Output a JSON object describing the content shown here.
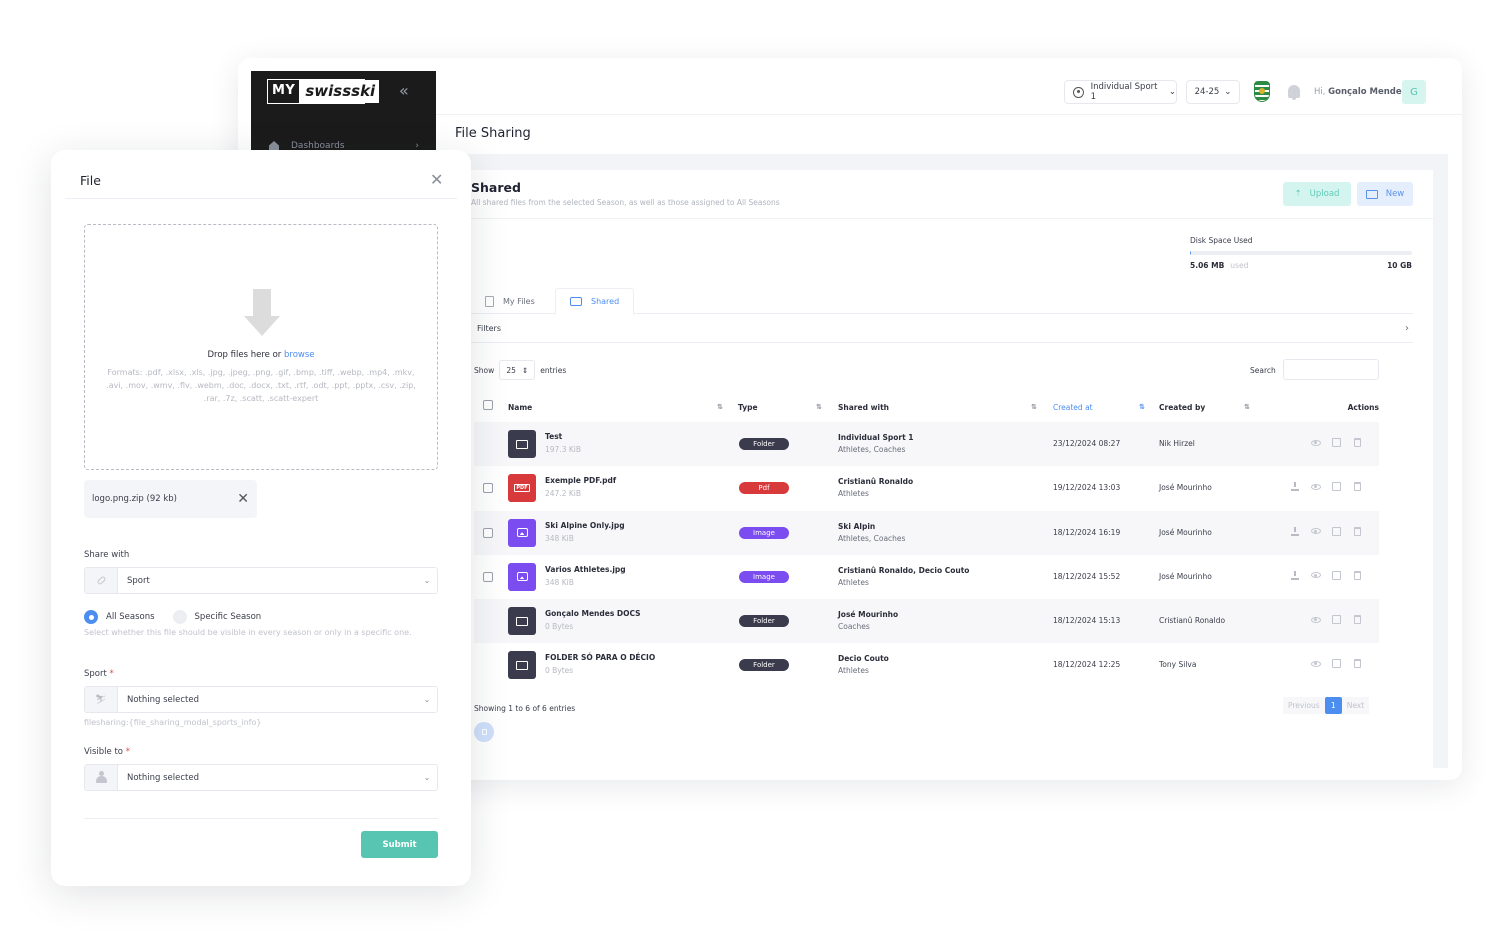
{
  "app": {
    "logo_left": "MY",
    "logo_right": "swissski",
    "sidebar_items": [
      {
        "label": "Dashboards",
        "icon": "home-icon"
      }
    ],
    "page_title": "File Sharing"
  },
  "topbar": {
    "sport_selector": "Individual Sport 1",
    "season_selector": "24-25",
    "greeting_prefix": "Hi,",
    "user_name": "Gonçalo Mendes",
    "avatar_initial": "G"
  },
  "card": {
    "title": "Shared",
    "subtitle": "All shared files from the selected Season, as well as those assigned to All Seasons",
    "upload_label": "Upload",
    "new_label": "New",
    "disk": {
      "label": "Disk Space Used",
      "used": "5.06 MB",
      "used_suffix": "used",
      "total": "10 GB",
      "fraction_used": 0.0005
    },
    "tabs": [
      {
        "label": "My Files",
        "active": false
      },
      {
        "label": "Shared",
        "active": true
      }
    ],
    "filters_label": "Filters",
    "show_label": "Show",
    "entries_value": "25",
    "entries_label": "entries",
    "search_label": "Search",
    "search_value": ""
  },
  "table": {
    "columns": [
      "Name",
      "Type",
      "Shared with",
      "Created at",
      "Created by",
      "Actions"
    ],
    "sorted_column": "Created at",
    "rows": [
      {
        "name": "Test",
        "size": "197.3 KiB",
        "kind": "folder",
        "type": "Folder",
        "shared_with": "Individual Sport 1",
        "shared_roles": "Athletes, Coaches",
        "created_at": "23/12/2024 08:27",
        "created_by": "Nik Hirzel",
        "has_checkbox": false,
        "downloadable": false
      },
      {
        "name": "Exemple PDF.pdf",
        "size": "247.2 KiB",
        "kind": "pdf",
        "type": "Pdf",
        "shared_with": "Cristianû Ronaldo",
        "shared_roles": "Athletes",
        "created_at": "19/12/2024 13:03",
        "created_by": "José Mourinho",
        "has_checkbox": true,
        "downloadable": true
      },
      {
        "name": "Ski Alpine Only.jpg",
        "size": "348 KiB",
        "kind": "image",
        "type": "Image",
        "shared_with": "Ski Alpin",
        "shared_roles": "Athletes, Coaches",
        "created_at": "18/12/2024 16:19",
        "created_by": "José Mourinho",
        "has_checkbox": true,
        "downloadable": true
      },
      {
        "name": "Varios Athletes.jpg",
        "size": "348 KiB",
        "kind": "image",
        "type": "Image",
        "shared_with": "Cristianû Ronaldo, Decio Couto",
        "shared_roles": "Athletes",
        "created_at": "18/12/2024 15:52",
        "created_by": "José Mourinho",
        "has_checkbox": true,
        "downloadable": true
      },
      {
        "name": "Gonçalo Mendes DOCS",
        "size": "0 Bytes",
        "kind": "folder",
        "type": "Folder",
        "shared_with": "José Mourinho",
        "shared_roles": "Coaches",
        "created_at": "18/12/2024 15:13",
        "created_by": "Cristianû Ronaldo",
        "has_checkbox": false,
        "downloadable": false
      },
      {
        "name": "FOLDER SÓ PARA O DÉCIO",
        "size": "0 Bytes",
        "kind": "folder",
        "type": "Folder",
        "shared_with": "Decio Couto",
        "shared_roles": "Athletes",
        "created_at": "18/12/2024 12:25",
        "created_by": "Tony Silva",
        "has_checkbox": false,
        "downloadable": false
      }
    ],
    "showing_text": "Showing 1 to 6 of 6 entries",
    "pagination": {
      "previous": "Previous",
      "current": "1",
      "next": "Next"
    }
  },
  "modal": {
    "title": "File",
    "dropzone_text": "Drop files here or",
    "dropzone_link": "browse",
    "formats": "Formats: .pdf, .xlsx, .xls, .jpg, .jpeg, .png, .gif, .bmp, .tiff, .webp, .mp4, .mkv, .avi, .mov, .wmv, .flv, .webm, .doc, .docx, .txt, .rtf, .odt, .ppt, .pptx, .csv, .zip, .rar, .7z, .scatt, .scatt-expert",
    "selected_file": "logo.png.zip (92 kb)",
    "share_with_label": "Share with",
    "share_with_value": "Sport",
    "season_options": [
      {
        "label": "All Seasons",
        "selected": true
      },
      {
        "label": "Specific Season",
        "selected": false
      }
    ],
    "season_help": "Select whether this file should be visible in every season or only in a specific one.",
    "sport_label": "Sport",
    "sport_value": "Nothing selected",
    "sport_help": "filesharing:{file_sharing_modal_sports_info}",
    "visible_label": "Visible to",
    "visible_value": "Nothing selected",
    "required_mark": "*",
    "submit_label": "Submit"
  }
}
